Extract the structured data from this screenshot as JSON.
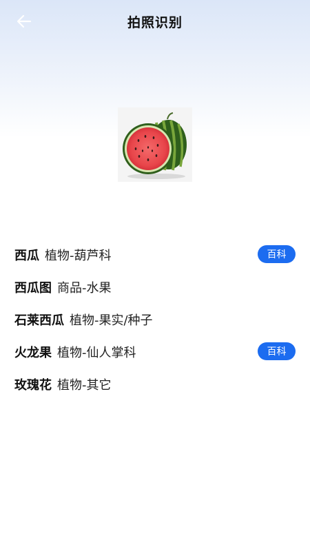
{
  "header": {
    "title": "拍照识别",
    "back_icon": "arrow-left-icon"
  },
  "photo": {
    "subject": "watermelon-image"
  },
  "results": [
    {
      "name": "西瓜",
      "category": "植物-葫芦科",
      "baike": "百科"
    },
    {
      "name": "西瓜图",
      "category": "商品-水果"
    },
    {
      "name": "石莱西瓜",
      "category": "植物-果实/种子"
    },
    {
      "name": "火龙果",
      "category": "植物-仙人掌科",
      "baike": "百科"
    },
    {
      "name": "玫瑰花",
      "category": "植物-其它"
    }
  ],
  "colors": {
    "accent": "#1c6cf0",
    "header_gradient_top": "#dbe6f8"
  }
}
